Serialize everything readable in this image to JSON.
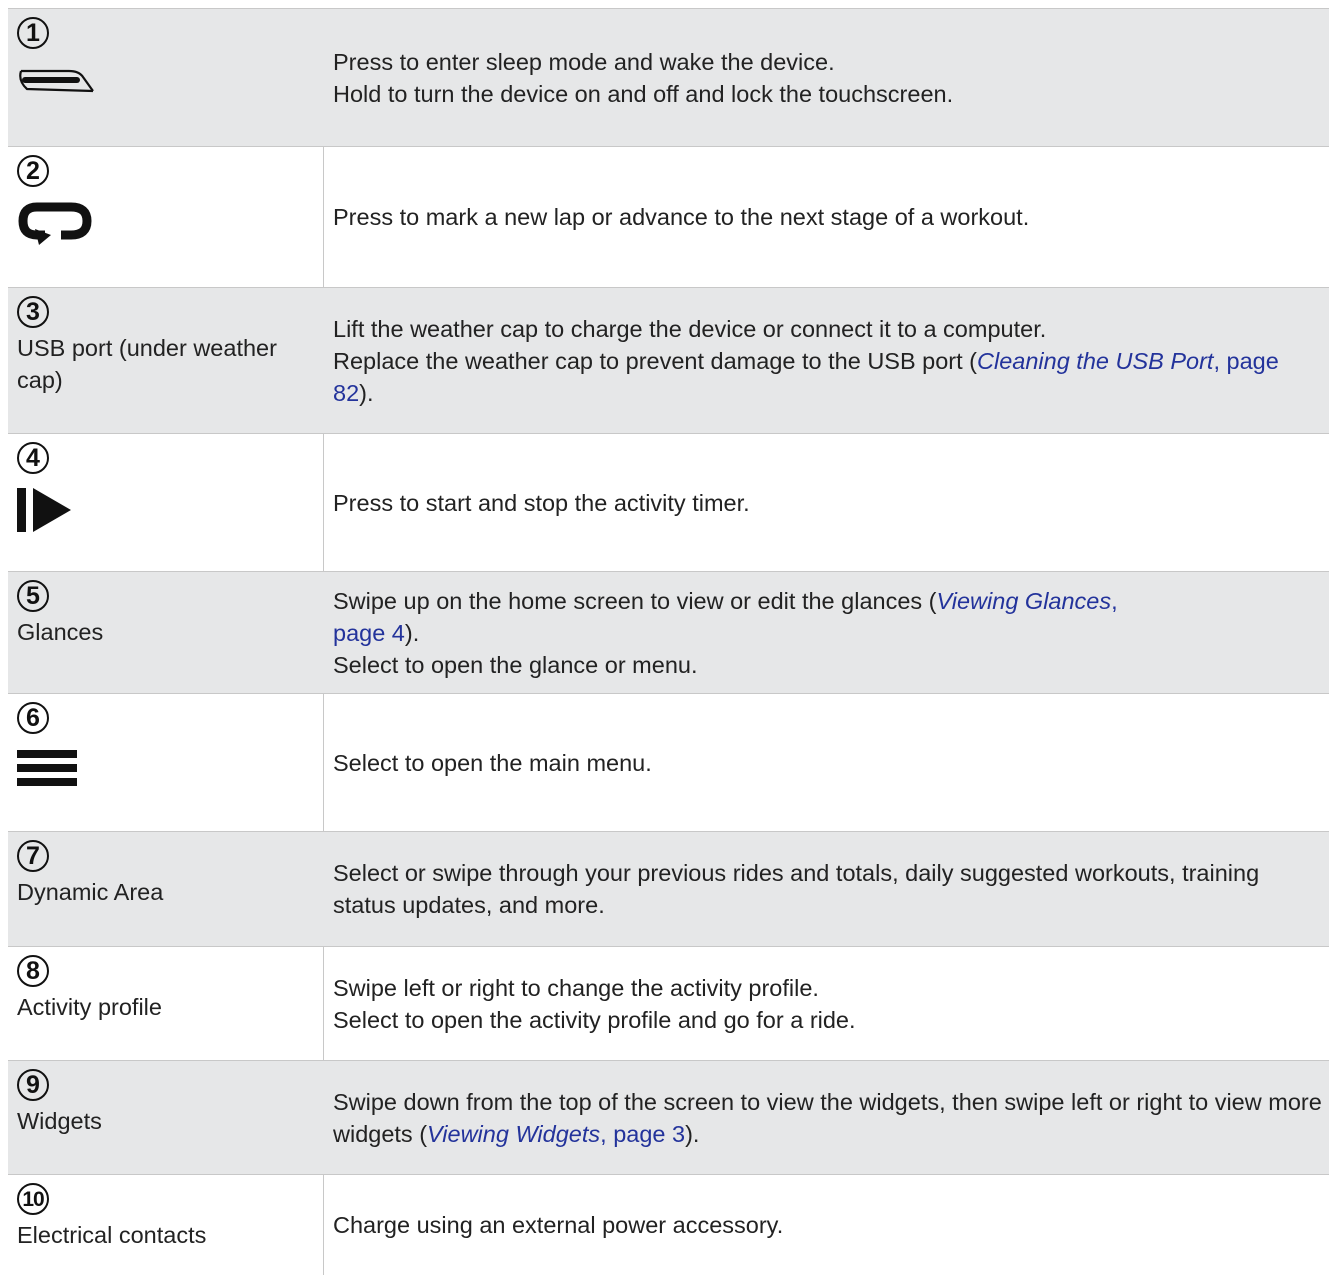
{
  "rows": [
    {
      "num": "1",
      "label": "",
      "icon": "power-button-icon",
      "desc": [
        "Press to enter sleep mode and wake the device.",
        "Hold to turn the device on and off and lock the touchscreen."
      ]
    },
    {
      "num": "2",
      "label": "",
      "icon": "lap-loop-icon",
      "desc": [
        "Press to mark a new lap or advance to the next stage of a workout."
      ]
    },
    {
      "num": "3",
      "label": "USB port (under weather cap)",
      "icon": "",
      "desc_a": "Lift the weather cap to charge the device or connect it to a computer.",
      "desc_b": "Replace the weather cap to prevent damage to the USB port (",
      "ref_title": "Cleaning the USB Port",
      "ref_page": "page 82",
      "desc_c": ")."
    },
    {
      "num": "4",
      "label": "",
      "icon": "start-stop-icon",
      "desc": [
        "Press to start and stop the activity timer."
      ]
    },
    {
      "num": "5",
      "label": "Glances",
      "icon": "",
      "desc_a": "Swipe up on the home screen to view or edit the glances (",
      "ref_title": "Viewing Glances",
      "ref_page": "page 4",
      "desc_c": ").",
      "desc_d": "Select to open the glance or menu."
    },
    {
      "num": "6",
      "label": "",
      "icon": "menu-icon",
      "desc": [
        "Select to open the main menu."
      ]
    },
    {
      "num": "7",
      "label": "Dynamic Area",
      "icon": "",
      "desc": [
        "Select or swipe through your previous rides and totals, daily suggested workouts, training status updates, and more."
      ]
    },
    {
      "num": "8",
      "label": "Activity profile",
      "icon": "",
      "desc": [
        "Swipe left or right to change the activity profile.",
        "Select to open the activity profile and go for a ride."
      ]
    },
    {
      "num": "9",
      "label": "Widgets",
      "icon": "",
      "desc_a": "Swipe down from the top of the screen to view the widgets, then swipe left or right to view more widgets (",
      "ref_title": "Viewing Widgets",
      "ref_page": "page 3",
      "desc_c": ")."
    },
    {
      "num": "10",
      "label": "Electrical contacts",
      "icon": "",
      "desc": [
        "Charge using an external power accessory."
      ]
    }
  ]
}
